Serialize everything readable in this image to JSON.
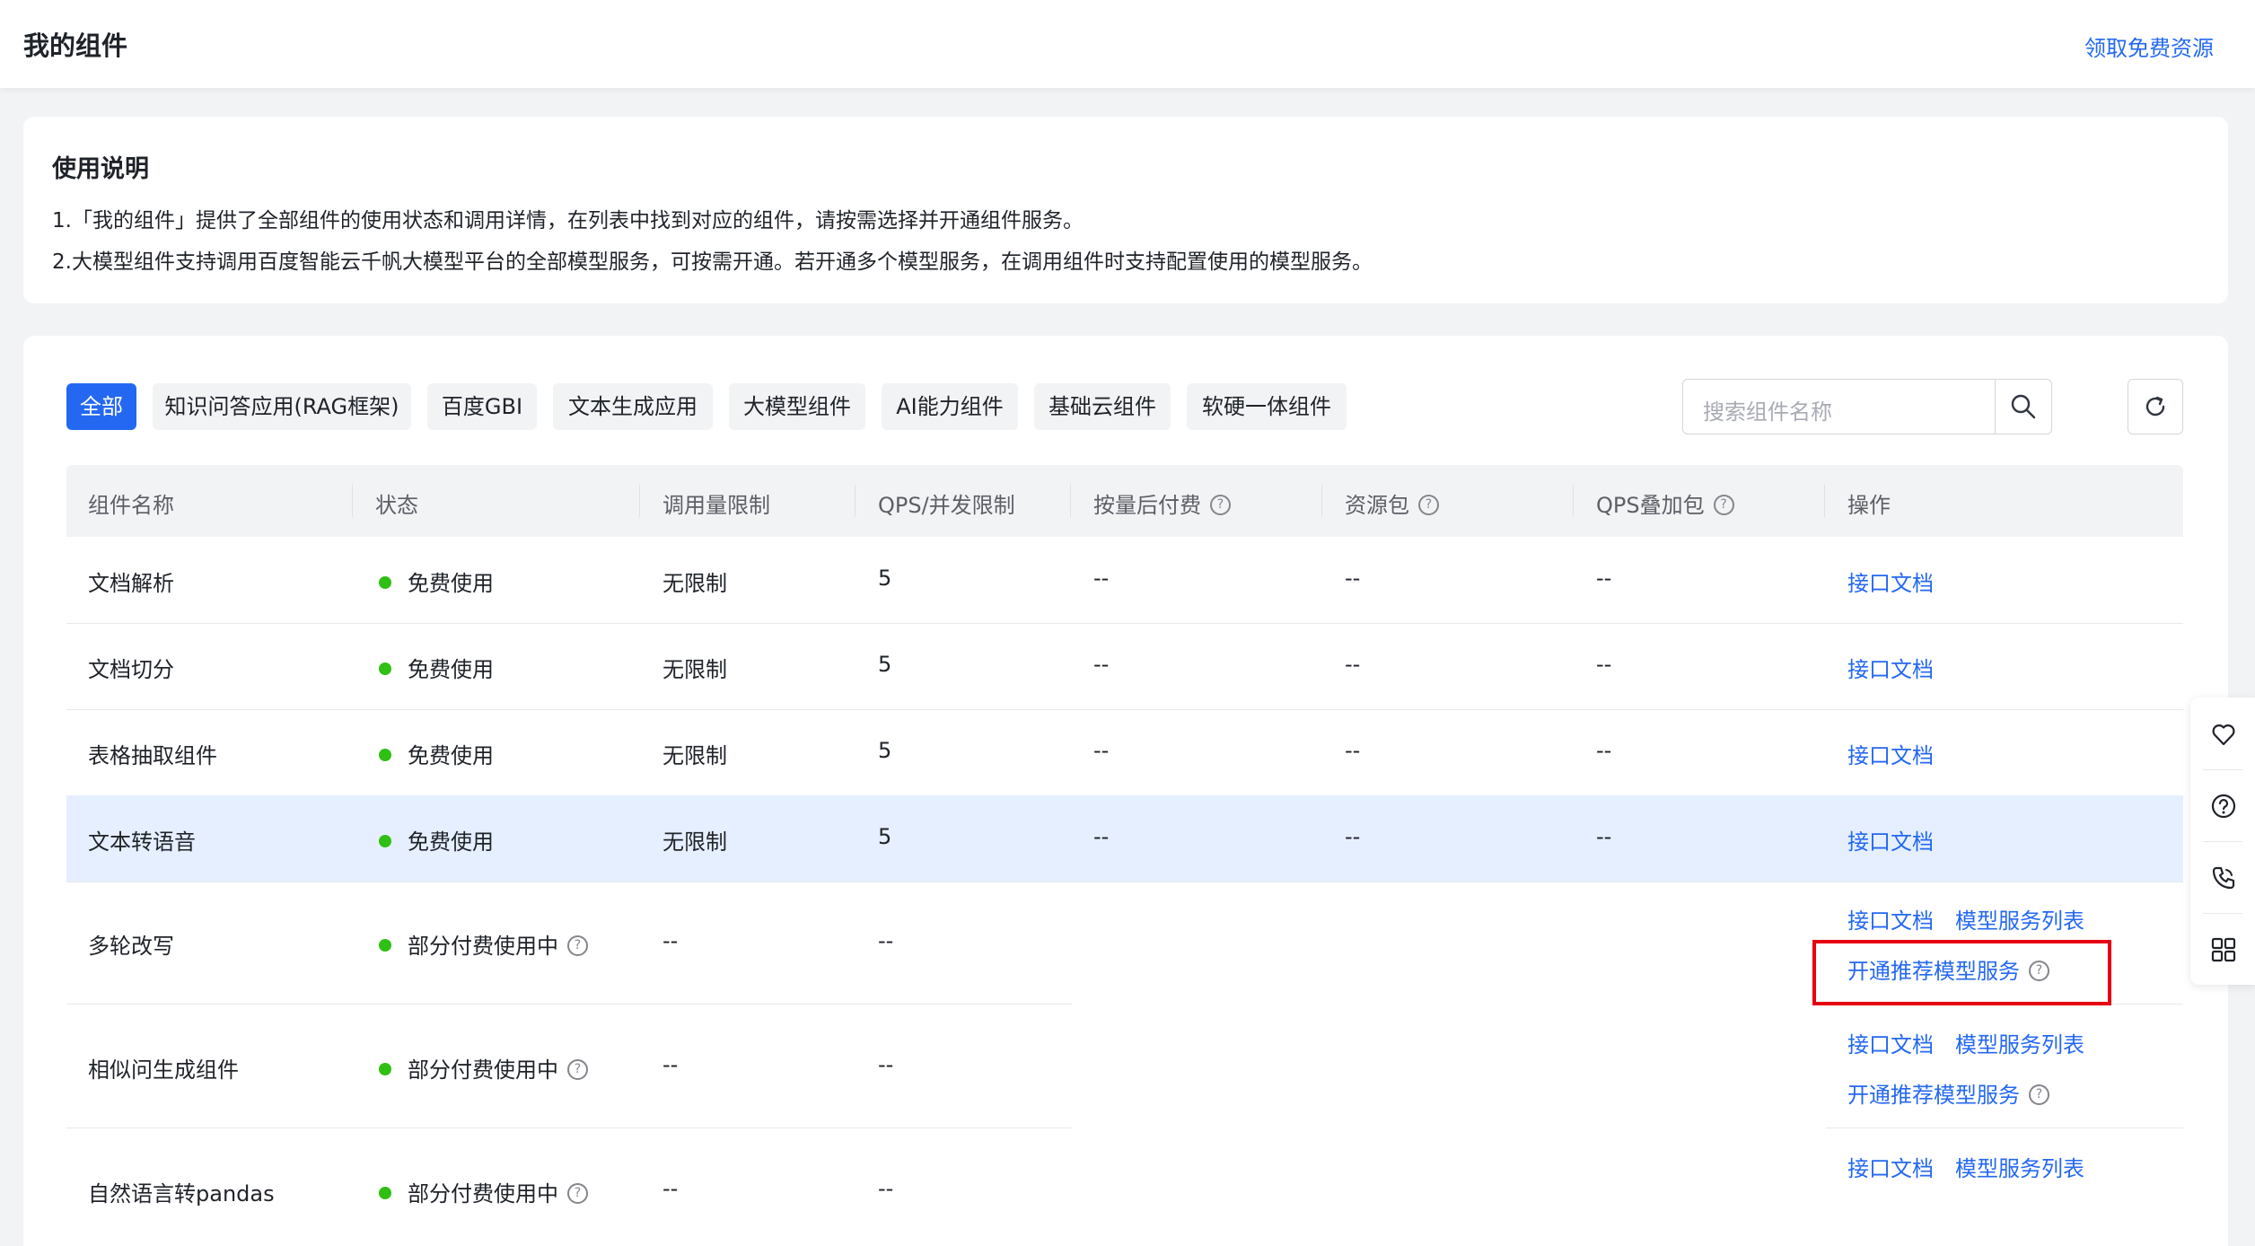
{
  "header": {
    "title": "我的组件",
    "promo_link": "领取免费资源"
  },
  "usage": {
    "heading": "使用说明",
    "line1": "1.「我的组件」提供了全部组件的使用状态和调用详情，在列表中找到对应的组件，请按需选择并开通组件服务。",
    "line2": "2.大模型组件支持调用百度智能云千帆大模型平台的全部模型服务，可按需开通。若开通多个模型服务，在调用组件时支持配置使用的模型服务。"
  },
  "filters": [
    "全部",
    "知识问答应用(RAG框架)",
    "百度GBI",
    "文本生成应用",
    "大模型组件",
    "AI能力组件",
    "基础云组件",
    "软硬一体组件"
  ],
  "active_filter": "全部",
  "search": {
    "placeholder": "搜索组件名称"
  },
  "table": {
    "columns": [
      "组件名称",
      "状态",
      "调用量限制",
      "QPS/并发限制",
      "按量后付费",
      "资源包",
      "QPS叠加包",
      "操作"
    ],
    "rows": [
      {
        "name": "文档解析",
        "status": "免费使用",
        "call_limit": "无限制",
        "qps": "5",
        "postpaid": "--",
        "package": "--",
        "qps_pack": "--",
        "actions": [
          "接口文档"
        ]
      },
      {
        "name": "文档切分",
        "status": "免费使用",
        "call_limit": "无限制",
        "qps": "5",
        "postpaid": "--",
        "package": "--",
        "qps_pack": "--",
        "actions": [
          "接口文档"
        ]
      },
      {
        "name": "表格抽取组件",
        "status": "免费使用",
        "call_limit": "无限制",
        "qps": "5",
        "postpaid": "--",
        "package": "--",
        "qps_pack": "--",
        "actions": [
          "接口文档"
        ]
      },
      {
        "name": "文本转语音",
        "status": "免费使用",
        "call_limit": "无限制",
        "qps": "5",
        "postpaid": "--",
        "package": "--",
        "qps_pack": "--",
        "actions": [
          "接口文档"
        ],
        "highlighted": true
      },
      {
        "name": "多轮改写",
        "status": "部分付费使用中",
        "call_limit": "--",
        "qps": "--",
        "actions": [
          "接口文档",
          "模型服务列表",
          "开通推荐模型服务"
        ]
      },
      {
        "name": "相似问生成组件",
        "status": "部分付费使用中",
        "call_limit": "--",
        "qps": "--",
        "actions": [
          "接口文档",
          "模型服务列表",
          "开通推荐模型服务"
        ]
      },
      {
        "name": "自然语言转pandas",
        "status": "部分付费使用中",
        "call_limit": "--",
        "qps": "--",
        "actions": [
          "接口文档",
          "模型服务列表"
        ]
      }
    ]
  },
  "colors": {
    "primary": "#2468f2",
    "success": "#30bf13",
    "highlight_row": "#e6efff",
    "annotation_box": "#e60012"
  },
  "sidebar_icons": [
    "heart-icon",
    "help-icon",
    "phone-icon",
    "grid-icon"
  ]
}
